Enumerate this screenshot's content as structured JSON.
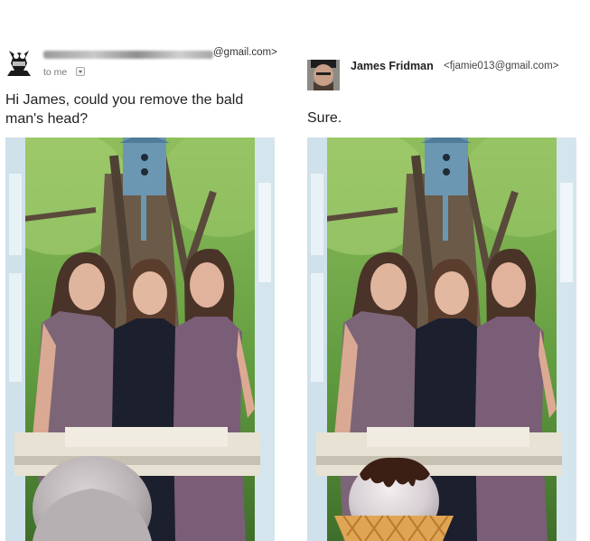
{
  "left_email": {
    "sender_email_suffix": "@gmail.com>",
    "to_label": "to me",
    "message": "Hi James, could you remove the bald man's head?"
  },
  "right_email": {
    "sender_name": "James Fridman",
    "sender_email": "<fjamie013@gmail.com>",
    "message": "Sure."
  },
  "icons": {
    "dropdown": "chevron-down-icon"
  },
  "colors": {
    "text": "#222222",
    "muted": "#777777",
    "birdhouse": "#5e8aa8",
    "dress_mauve": "#7c6577",
    "dress_navy": "#1c1f2d"
  }
}
